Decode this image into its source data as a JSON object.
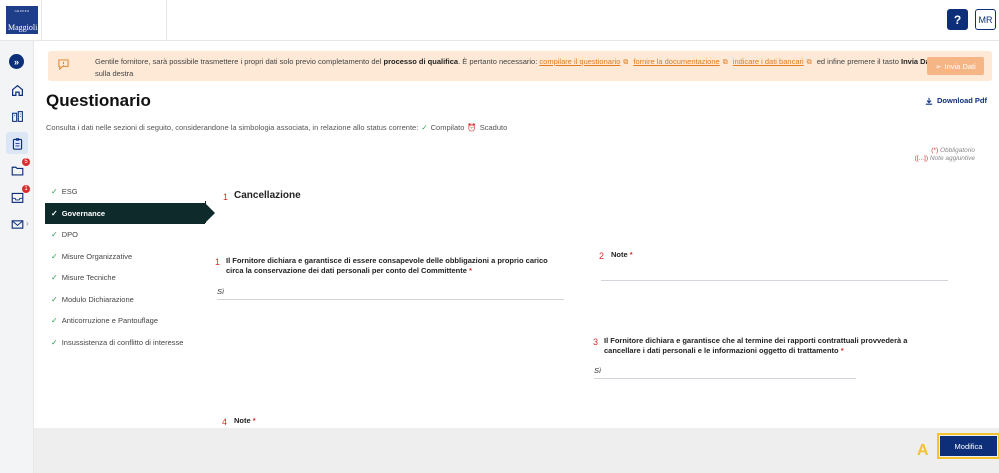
{
  "header": {
    "logo_small": "GRUPPO",
    "logo_brand": "Maggioli",
    "help_label": "?",
    "user_initials": "MR"
  },
  "sidebar": {
    "badges": {
      "folder": "5",
      "inbox": "1"
    }
  },
  "notice": {
    "text_before": "Gentile fornitore, sarà possibile trasmettere i propri dati solo previo completamento del",
    "bold_process": "processo di qualifica",
    "text_mid": ". È pertanto necessario:",
    "links": [
      "compilare il questionario",
      "fornire la documentazione",
      "indicare i dati bancari"
    ],
    "text_after": "ed infine premere il tasto",
    "bold_send": "Invia Dati",
    "text_end": "sulla destra",
    "send_button": "Invia Dati"
  },
  "page": {
    "title": "Questionario",
    "download_label": "Download Pdf",
    "subtitle": "Consulta i dati nelle sezioni di seguito, considerandone la simbologia associata, in relazione allo status corrente:",
    "status_compiled": "Compilato",
    "status_expired": "Scaduto",
    "legend_required_mark": "(*)",
    "legend_required": "Obbligatorio",
    "legend_notes_mark": "([...])",
    "legend_notes": "Note aggiuntive"
  },
  "nav": {
    "items": [
      {
        "label": "ESG",
        "active": false
      },
      {
        "label": "Governance",
        "active": true
      },
      {
        "label": "DPO",
        "active": false
      },
      {
        "label": "Misure Organizzative",
        "active": false
      },
      {
        "label": "Misure Tecniche",
        "active": false
      },
      {
        "label": "Modulo Dichiarazione",
        "active": false
      },
      {
        "label": "Anticorruzione e Pantouflage",
        "active": false
      },
      {
        "label": "Insussistenza di conflitto di interesse",
        "active": false
      }
    ]
  },
  "section": {
    "number": "1",
    "title": "Cancellazione",
    "questions": [
      {
        "number": "1",
        "text": "Il Fornitore dichiara e garantisce di essere consapevole delle obbligazioni a proprio carico circa la conservazione dei dati personali per conto del Committente",
        "req": "*",
        "answer": "Sì"
      },
      {
        "number": "2",
        "text": "Note",
        "req": "*",
        "answer": ""
      },
      {
        "number": "3",
        "text": "Il Fornitore dichiara e garantisce che al termine dei rapporti contrattuali provvederà a cancellare i dati personali e le informazioni oggetto di trattamento",
        "req": "*",
        "answer": "Sì"
      },
      {
        "number": "4",
        "text": "Note",
        "req": "*",
        "answer": ""
      }
    ]
  },
  "footer": {
    "edit_button": "Modifica",
    "marker": "A"
  },
  "colors": {
    "primary": "#0d2f7a",
    "accent": "#e07b1f",
    "notice_bg": "#fde9d6",
    "active_nav": "#0f2a2a",
    "required": "#d92d2d",
    "success": "#2e9e4f",
    "highlight": "#f2c230"
  }
}
